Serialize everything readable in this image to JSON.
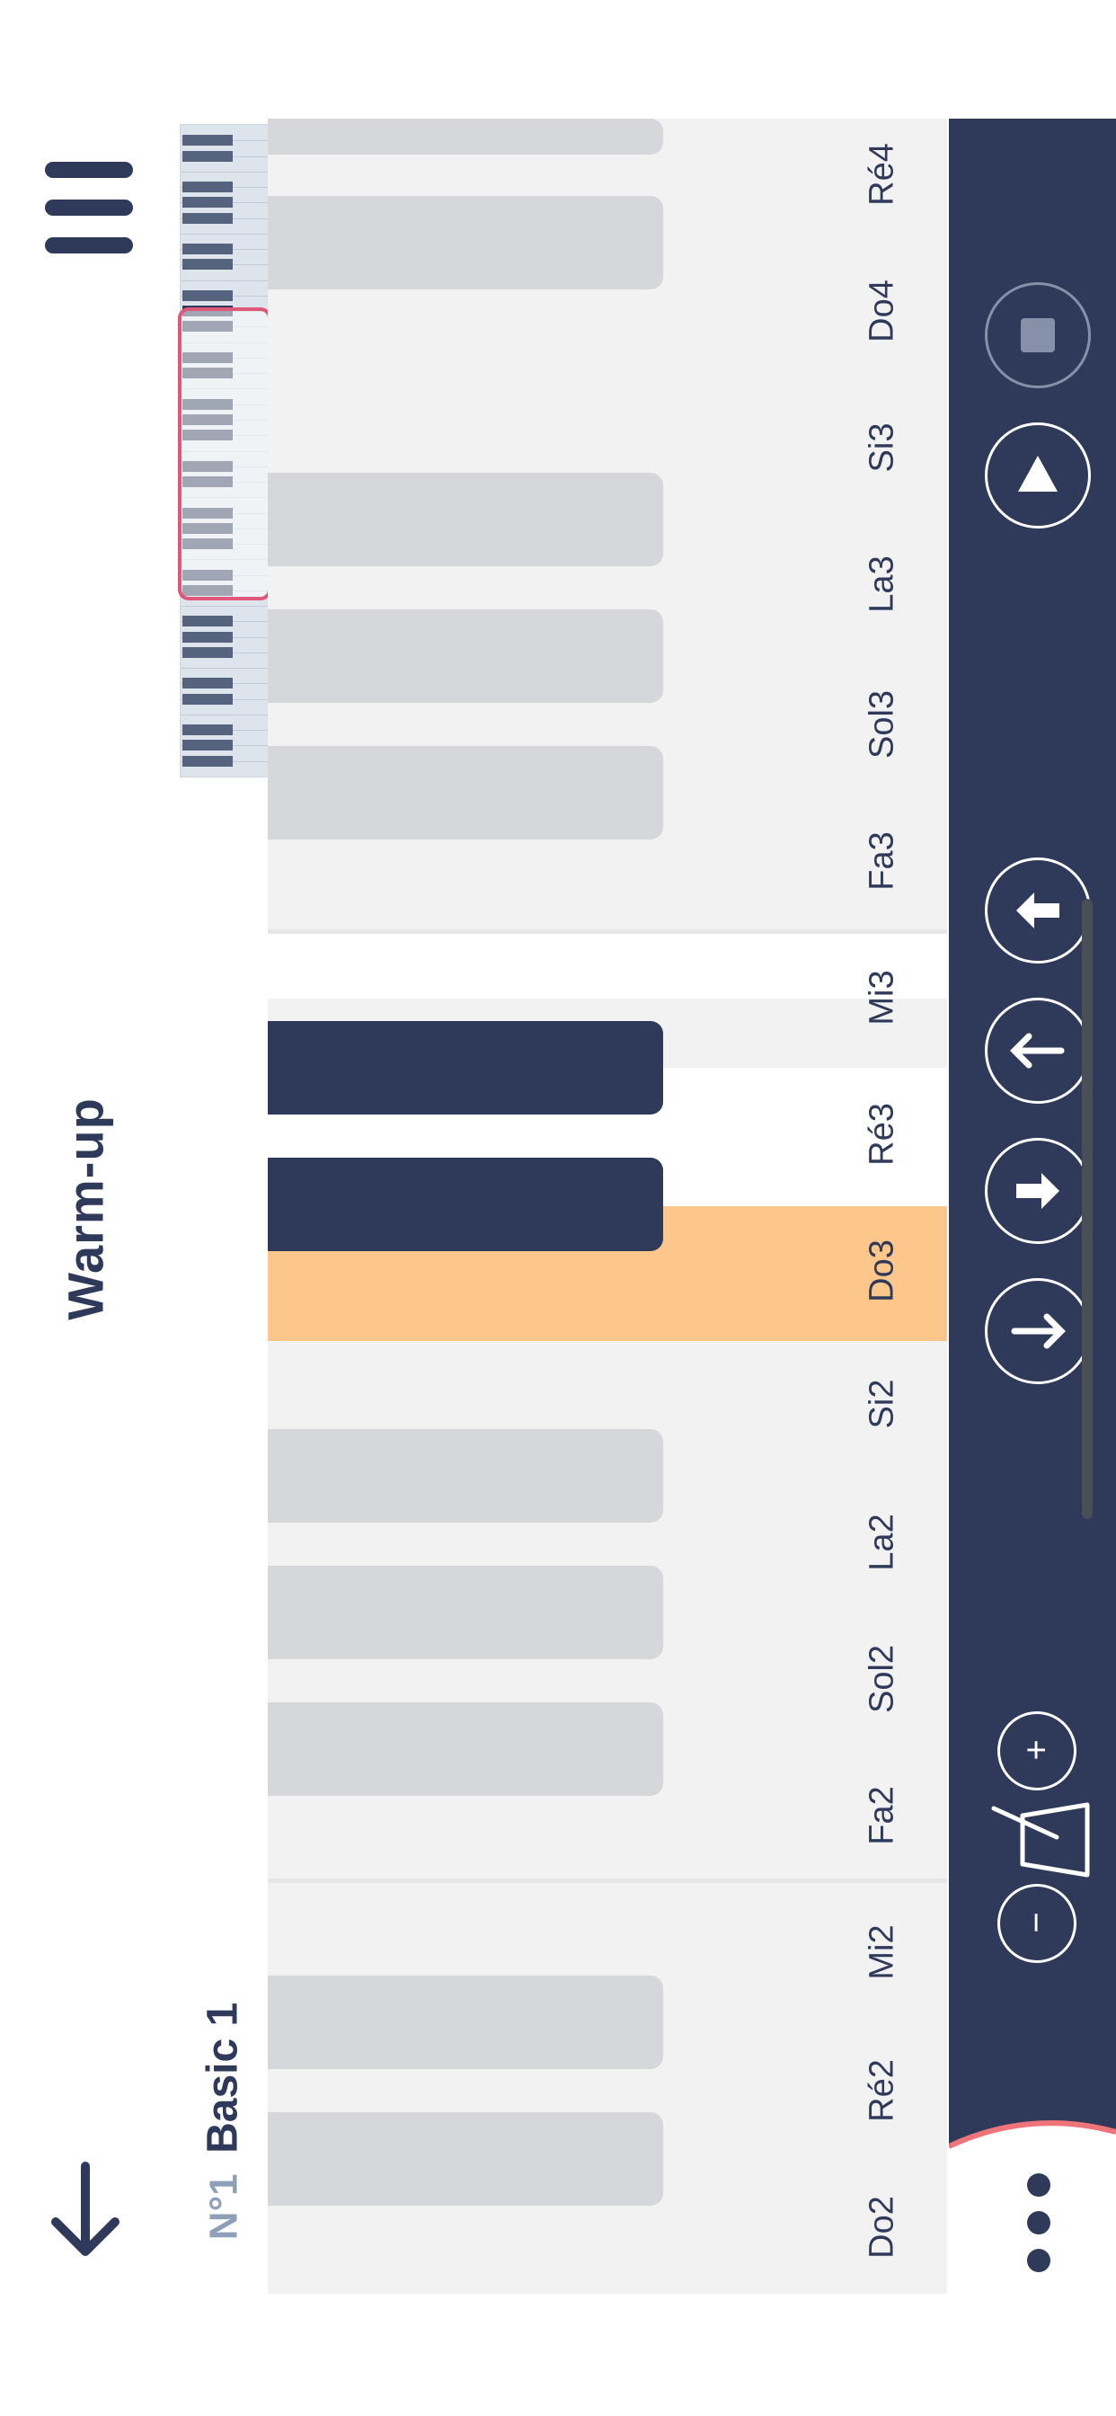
{
  "header": {
    "title": "Warm-up",
    "menu_icon": "bars-menu-icon",
    "back_icon": "arrow-down-icon"
  },
  "exercise": {
    "number": "N°1",
    "name": "Basic 1"
  },
  "notes": [
    {
      "label": "Ré4"
    },
    {
      "label": "Do4"
    },
    {
      "label": "Si3"
    },
    {
      "label": "La3"
    },
    {
      "label": "Sol3"
    },
    {
      "label": "Fa3"
    },
    {
      "label": "Mi3"
    },
    {
      "label": "Ré3"
    },
    {
      "label": "Do3"
    },
    {
      "label": "Si2"
    },
    {
      "label": "La2"
    },
    {
      "label": "Sol2"
    },
    {
      "label": "Fa2"
    },
    {
      "label": "Mi2"
    },
    {
      "label": "Ré2"
    },
    {
      "label": "Do2"
    }
  ],
  "playback": {
    "current_note": "Do3",
    "active_notes": [
      "Do3",
      "Ré3"
    ]
  },
  "controls": {
    "tempo_minus": "−",
    "tempo_plus": "+",
    "icons": [
      "stop-icon",
      "play-icon",
      "arrow-double-up-icon",
      "arrow-up-icon",
      "arrow-double-down-icon",
      "arrow-down-icon",
      "metronome-icon",
      "more-icon"
    ]
  },
  "colors": {
    "navy": "#2f3a5b",
    "highlight": "#fdc68a",
    "accent_pink": "#e0577a"
  }
}
